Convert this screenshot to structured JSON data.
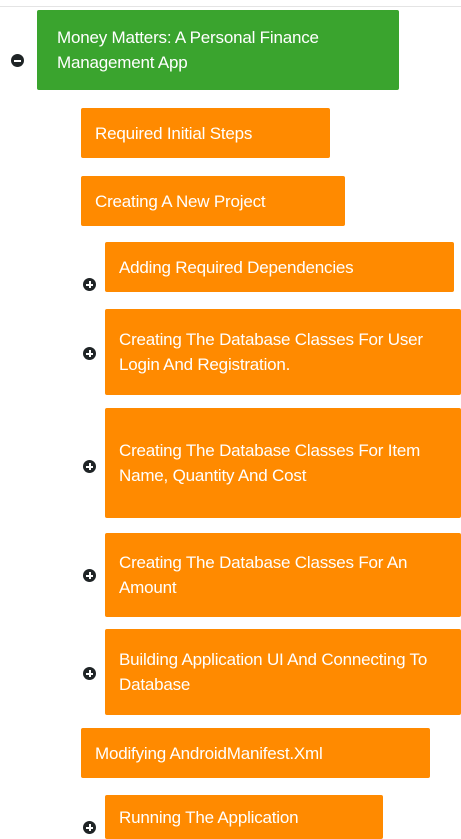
{
  "mindmap": {
    "root": {
      "label": "Money Matters: A Personal Finance Management App",
      "expanded": true
    },
    "children": [
      {
        "label": "Required Initial Steps",
        "has_children": false
      },
      {
        "label": "Creating A New Project",
        "has_children": false
      },
      {
        "label": "Adding Required Dependencies",
        "has_children": true,
        "expanded": false
      },
      {
        "label": "Creating The Database Classes For User Login And Registration.",
        "has_children": true,
        "expanded": false
      },
      {
        "label": "Creating The Database Classes For Item Name, Quantity And Cost",
        "has_children": true,
        "expanded": false
      },
      {
        "label": "Creating The Database Classes For An Amount",
        "has_children": true,
        "expanded": false
      },
      {
        "label": "Building Application UI And Connecting To Database",
        "has_children": true,
        "expanded": false
      },
      {
        "label": "Modifying AndroidManifest.Xml",
        "has_children": false
      },
      {
        "label": "Running The Application",
        "has_children": true,
        "expanded": false
      }
    ],
    "colors": {
      "root": "#3aa42e",
      "child": "#ff8a00",
      "toggle": "#1f2426"
    },
    "icons": {
      "collapse": "minus-circle-icon",
      "expand": "plus-circle-icon"
    }
  }
}
